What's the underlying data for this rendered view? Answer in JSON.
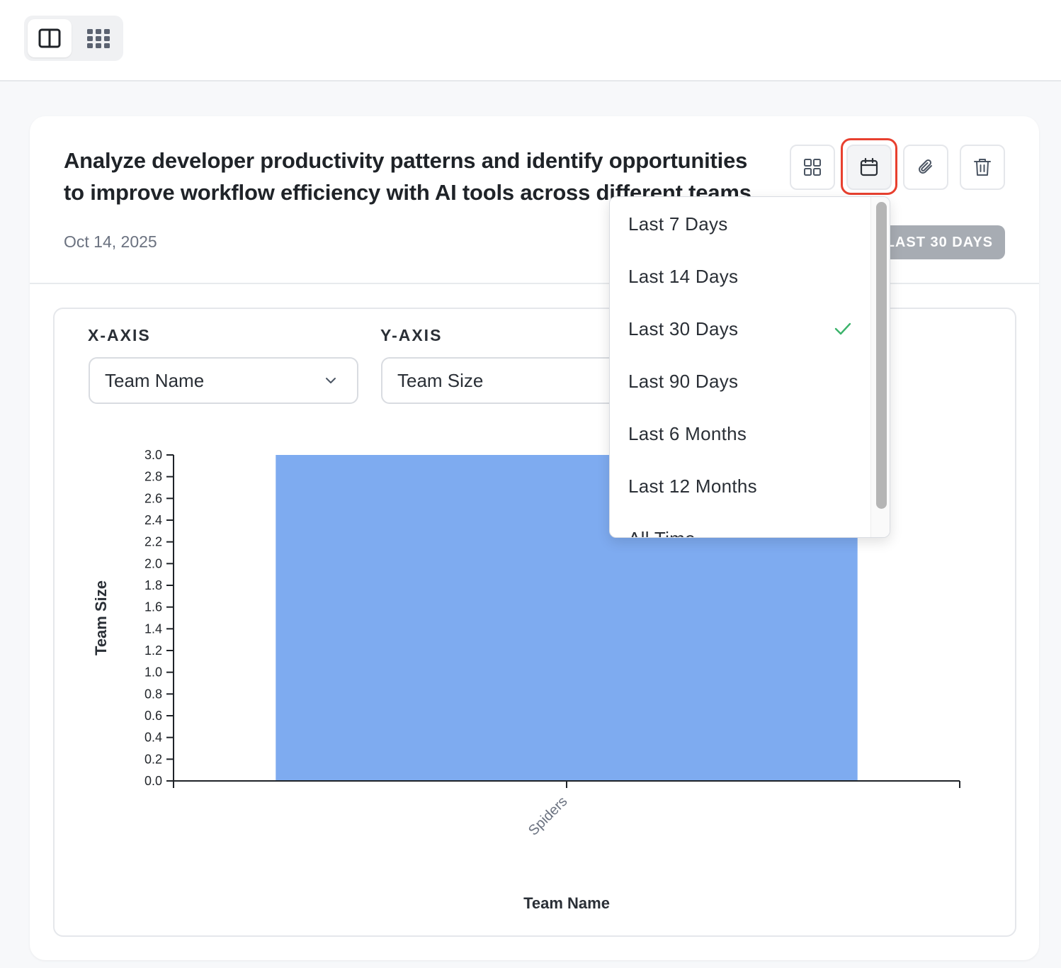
{
  "view_toggle": {
    "options": [
      "split-view",
      "grid-view"
    ],
    "active": "split-view"
  },
  "card": {
    "title": "Analyze developer productivity patterns and identify opportunities to improve workflow efficiency with AI tools across different teams",
    "date": "Oct 14, 2025",
    "range_badge": "LAST 30 DAYS",
    "actions": [
      "grid-icon",
      "calendar-icon",
      "paperclip-icon",
      "trash-icon"
    ],
    "highlight_color": "#e8402f"
  },
  "axes_controls": {
    "x_label": "X-AXIS",
    "x_value": "Team Name",
    "y_label": "Y-AXIS",
    "y_value": "Team Size"
  },
  "date_range_menu": {
    "options": [
      {
        "label": "Last 7 Days",
        "selected": false
      },
      {
        "label": "Last 14 Days",
        "selected": false
      },
      {
        "label": "Last 30 Days",
        "selected": true
      },
      {
        "label": "Last 90 Days",
        "selected": false
      },
      {
        "label": "Last 6 Months",
        "selected": false
      },
      {
        "label": "Last 12 Months",
        "selected": false
      },
      {
        "label": "All Time",
        "selected": false
      }
    ],
    "check_color": "#3bb36b"
  },
  "chart_data": {
    "type": "bar",
    "categories": [
      "Spiders"
    ],
    "values": [
      3
    ],
    "xlabel": "Team Name",
    "ylabel": "Team Size",
    "ylim": [
      0,
      3
    ],
    "yticks": [
      "0.0",
      "0.2",
      "0.4",
      "0.6",
      "0.8",
      "1.0",
      "1.2",
      "1.4",
      "1.6",
      "1.8",
      "2.0",
      "2.2",
      "2.4",
      "2.6",
      "2.8",
      "3.0"
    ],
    "bar_color": "#7eabf0",
    "grid": false,
    "legend": "none"
  }
}
